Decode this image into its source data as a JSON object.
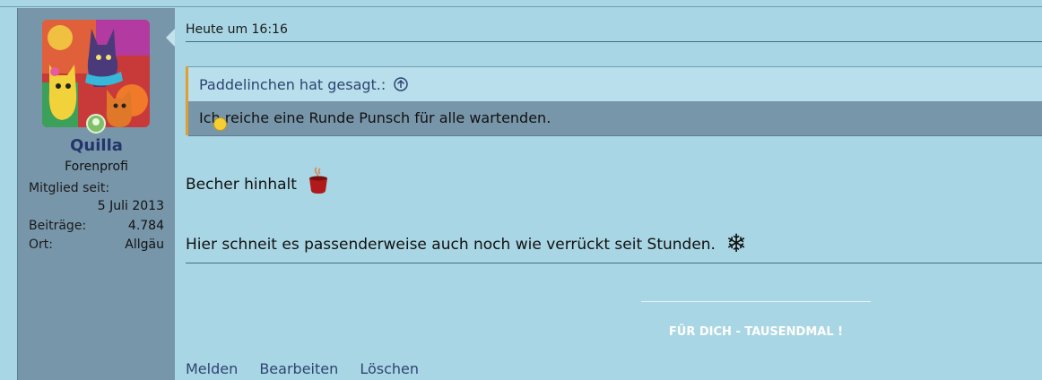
{
  "user": {
    "name": "Quilla",
    "title": "Forenprofi",
    "info": [
      {
        "key": "Mitglied seit:",
        "value": "5 Juli 2013"
      },
      {
        "key": "Beiträge:",
        "value": "4.784"
      },
      {
        "key": "Ort:",
        "value": "Allgäu"
      }
    ],
    "online_icon": "online-status-icon"
  },
  "post": {
    "date": "Heute um 16:16",
    "quote": {
      "author": "Paddelinchen hat gesagt.:",
      "arrow_icon": "circle-arrow-up-icon",
      "text": "Ich reiche eine Runde Punsch für alle wartenden."
    },
    "line1": "Becher hinhalt",
    "line2": "Hier schneit es passenderweise auch noch wie verrückt seit Stunden.",
    "signature": "FÜR DICH - TAUSENDMAL !"
  },
  "actions": [
    "Melden",
    "Bearbeiten",
    "Löschen"
  ],
  "colors": {
    "background": "#a9d6e4",
    "sidebar": "#7896aa",
    "username": "#23356b",
    "quote_accent": "#e39d2c"
  }
}
